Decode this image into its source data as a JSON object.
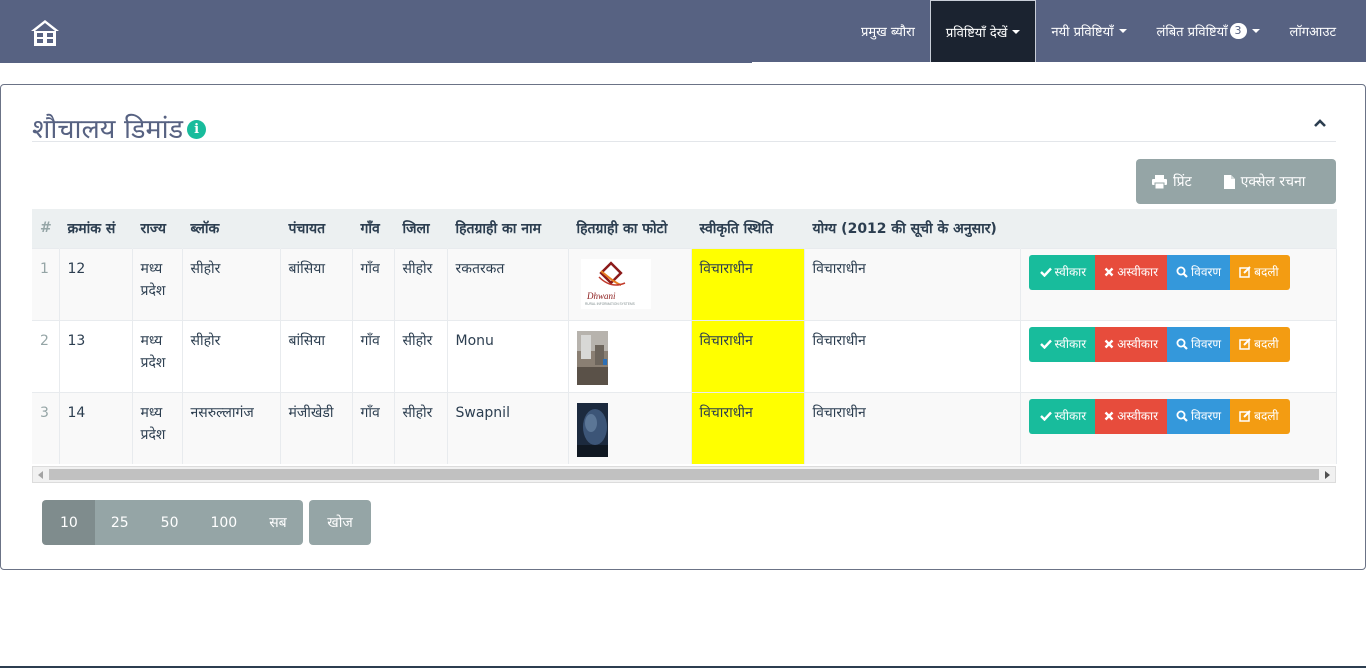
{
  "navbar": {
    "items": [
      {
        "label": "प्रमुख ब्यौरा"
      },
      {
        "label": "प्रविष्टियाँ देखें"
      },
      {
        "label": "नयी प्रविष्टियाँ"
      },
      {
        "label": "लंबित प्रविष्टियाँ",
        "badge": "3"
      },
      {
        "label": "लॉगआउट"
      }
    ]
  },
  "panel": {
    "title": "शौचालय डिमांड",
    "info_icon_glyph": "i",
    "export": {
      "print_label": "प्रिंट",
      "excel_label": "एक्सेल रचना"
    }
  },
  "table": {
    "headers": [
      "#",
      "क्रमांक सं",
      "राज्य",
      "ब्लॉक",
      "पंचायत",
      "गाँव",
      "जिला",
      "हितग्राही का नाम",
      "हितग्राही का फोटो",
      "स्वीकृति स्थिति",
      "योग्य (2012 की सूची के अनुसार)",
      ""
    ],
    "rows": [
      {
        "idx": "1",
        "serial": "12",
        "state": "मध्य प्रदेश",
        "block": "सीहोर",
        "panchayat": "बांसिया",
        "village": "गाँव",
        "district": "सीहोर",
        "name": "रकतरकत",
        "photo": "dhwani-logo",
        "status": "विचाराधीन",
        "eligible": "विचाराधीन"
      },
      {
        "idx": "2",
        "serial": "13",
        "state": "मध्य प्रदेश",
        "block": "सीहोर",
        "panchayat": "बांसिया",
        "village": "गाँव",
        "district": "सीहोर",
        "name": "Monu",
        "photo": "photo-room",
        "status": "विचाराधीन",
        "eligible": "विचाराधीन"
      },
      {
        "idx": "3",
        "serial": "14",
        "state": "मध्य प्रदेश",
        "block": "नसरुल्लागंज",
        "panchayat": "मंजीखेडी",
        "village": "गाँव",
        "district": "सीहोर",
        "name": "Swapnil",
        "photo": "photo-dark",
        "status": "विचाराधीन",
        "eligible": "विचाराधीन"
      }
    ],
    "actions": {
      "accept": "स्वीकार",
      "reject": "अस्वीकार",
      "detail": "विवरण",
      "edit": "बदली"
    }
  },
  "logo": {
    "brand_text": "Dhwani",
    "brand_subtext": "RURAL INFORMATION SYSTEMS"
  },
  "pagination": {
    "sizes": [
      "10",
      "25",
      "50",
      "100",
      "सब"
    ],
    "selected": "10",
    "search_label": "खोज"
  },
  "colors": {
    "navbar": "#576282",
    "accent_green": "#18bc9c",
    "danger": "#e74c3c",
    "info": "#3498db",
    "warning": "#f39c12",
    "status_highlight": "#ffff00"
  }
}
